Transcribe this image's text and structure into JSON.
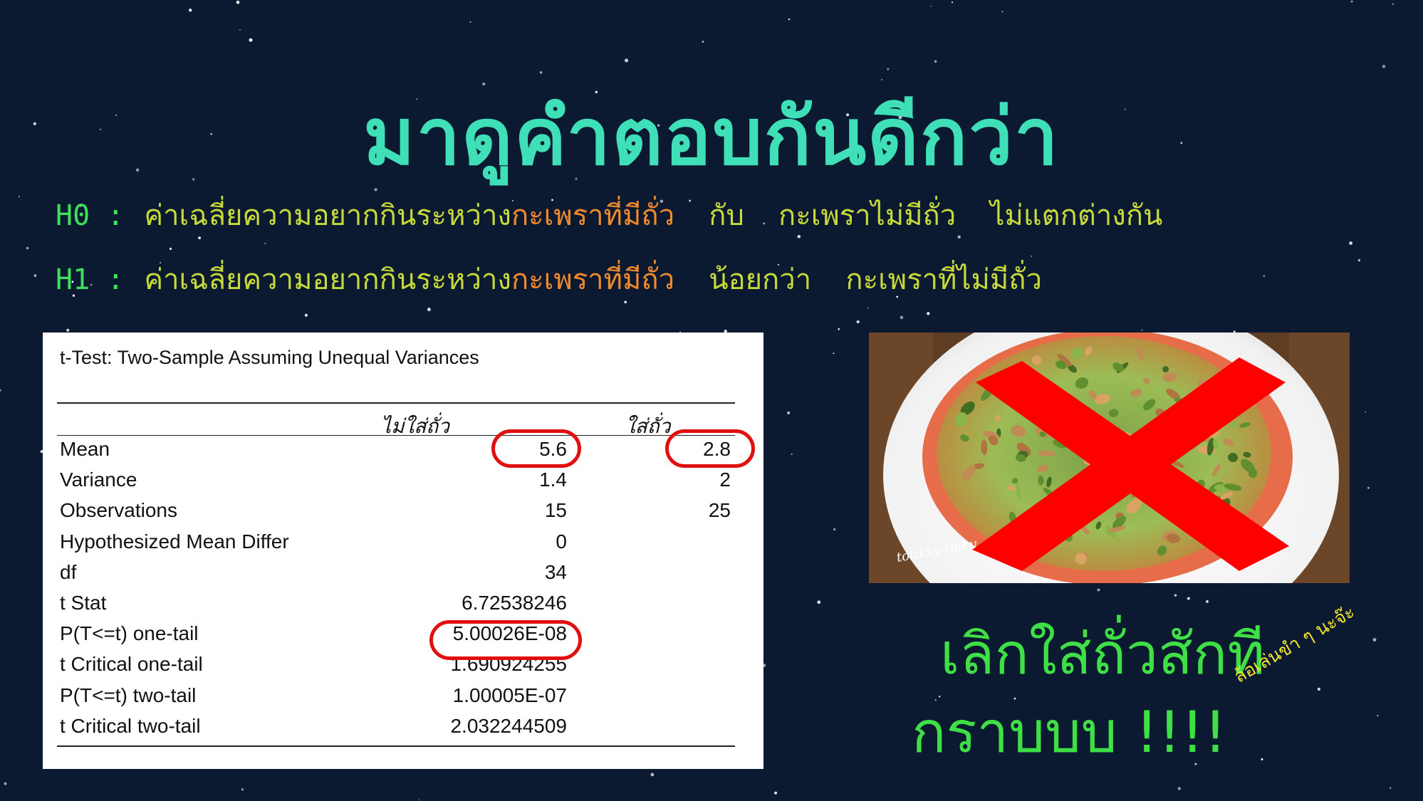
{
  "title": "มาดูคำตอบกันดีกว่า",
  "hypotheses": [
    {
      "label": "H0 :",
      "pre": "ค่าเฉลี่ยความอยากกินระหว่าง",
      "a": "กะเพราที่มีถั่ว",
      "mid": "กับ",
      "b": "กะเพราไม่มีถั่ว",
      "post": "ไม่แตกต่างกัน"
    },
    {
      "label": "H1 :",
      "pre": "ค่าเฉลี่ยความอยากกินระหว่าง",
      "a": "กะเพราที่มีถั่ว",
      "mid": "น้อยกว่า",
      "b": "กะเพราที่ไม่มีถั่ว",
      "post": ""
    }
  ],
  "stats_table": {
    "title": "t-Test: Two-Sample Assuming Unequal Variances",
    "col1": "ไม่ใส่ถั่ว",
    "col2": "ใส่ถั่ว",
    "rows": [
      {
        "label": "Mean",
        "v1": "5.6",
        "v2": "2.8"
      },
      {
        "label": "Variance",
        "v1": "1.4",
        "v2": "2"
      },
      {
        "label": "Observations",
        "v1": "15",
        "v2": "25"
      },
      {
        "label": "Hypothesized Mean Differ",
        "v1": "0",
        "v2": ""
      },
      {
        "label": "df",
        "v1": "34",
        "v2": ""
      },
      {
        "label": "t Stat",
        "v1": "6.72538246",
        "v2": ""
      },
      {
        "label": "P(T<=t) one-tail",
        "v1": "5.00026E-08",
        "v2": ""
      },
      {
        "label": "t Critical one-tail",
        "v1": "1.690924255",
        "v2": ""
      },
      {
        "label": "P(T<=t) two-tail",
        "v1": "1.00005E-07",
        "v2": ""
      },
      {
        "label": "t Critical two-tail",
        "v1": "2.032244509",
        "v2": ""
      }
    ]
  },
  "photo": {
    "watermark": "totikky tikky",
    "icon": "cross-out-mark"
  },
  "conclusion": {
    "line1": "เลิกใส่ถั่วสักที",
    "line2": "กราบบบ !!!!"
  },
  "joke": "ล้อเล่นขำ ๆ นะจ๊ะ",
  "colors": {
    "background": "#0b1a30",
    "title": "#3fe0b8",
    "label": "#3ee05a",
    "text": "#c8d93a",
    "highlight": "#f08a2c",
    "cross": "#ff0000",
    "circle": "#e01010"
  }
}
